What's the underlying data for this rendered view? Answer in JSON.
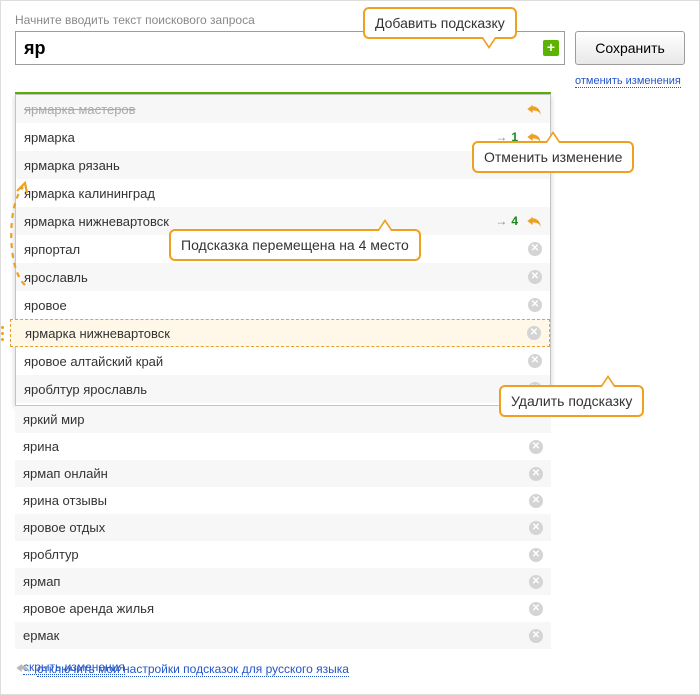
{
  "hint": "Начните вводить текст поискового запроса",
  "search_value": "яр",
  "buttons": {
    "save": "Сохранить",
    "cancel_changes": "отменить изменения",
    "hide_changes": "скрыть изменения",
    "disable_settings": "отключить мои настройки подсказок для русского языка"
  },
  "callouts": {
    "add": "Добавить подсказку",
    "undo": "Отменить изменение",
    "moved": "Подсказка перемещена на 4 место",
    "delete": "Удалить подсказку"
  },
  "panel_rows": [
    {
      "text": "ярмарка мастеров",
      "state": "striked",
      "tail": "undo"
    },
    {
      "text": "ярмарка",
      "state": "normal",
      "moved_to": "1",
      "tail": "undo"
    },
    {
      "text": "ярмарка рязань",
      "state": "normal",
      "tail": "none"
    },
    {
      "text": "ярмарка калининград",
      "state": "normal",
      "tail": "none"
    },
    {
      "text": "ярмарка нижневартовск",
      "state": "normal",
      "moved_to": "4",
      "tail": "undo"
    },
    {
      "text": "ярпортал",
      "state": "normal",
      "tail": "delete"
    },
    {
      "text": "ярославль",
      "state": "normal",
      "tail": "delete"
    },
    {
      "text": "яровое",
      "state": "normal",
      "tail": "delete"
    },
    {
      "text": "ярмарка нижневартовск",
      "state": "highlight",
      "tail": "delete"
    },
    {
      "text": "яровое алтайский край",
      "state": "normal",
      "tail": "delete"
    },
    {
      "text": "ярoблтур ярославль",
      "state": "normal",
      "tail": "delete"
    }
  ],
  "lower_rows": [
    {
      "text": "яркий мир",
      "tail": "none"
    },
    {
      "text": "ярина",
      "tail": "delete"
    },
    {
      "text": "ярмап онлайн",
      "tail": "delete"
    },
    {
      "text": "ярина отзывы",
      "tail": "delete"
    },
    {
      "text": "яровое отдых",
      "tail": "delete"
    },
    {
      "text": "ярoблтур",
      "tail": "delete"
    },
    {
      "text": "ярмап",
      "tail": "delete"
    },
    {
      "text": "яровое аренда жилья",
      "tail": "delete"
    },
    {
      "text": "ермак",
      "tail": "delete"
    }
  ]
}
